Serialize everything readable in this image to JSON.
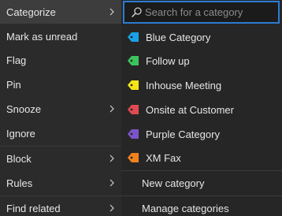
{
  "menu": {
    "items": [
      {
        "label": "Categorize",
        "has_submenu": true,
        "active": true
      },
      {
        "label": "Mark as unread",
        "has_submenu": false
      },
      {
        "label": "Flag",
        "has_submenu": false
      },
      {
        "label": "Pin",
        "has_submenu": false
      },
      {
        "label": "Snooze",
        "has_submenu": true
      },
      {
        "label": "Ignore",
        "has_submenu": false
      },
      {
        "label": "Block",
        "has_submenu": true
      },
      {
        "label": "Rules",
        "has_submenu": true
      },
      {
        "label": "Find related",
        "has_submenu": true
      }
    ]
  },
  "submenu": {
    "search_placeholder": "Search for a category",
    "categories": [
      {
        "label": "Blue Category",
        "color": "#1aa1e6"
      },
      {
        "label": "Follow up",
        "color": "#3cc45c"
      },
      {
        "label": "Inhouse Meeting",
        "color": "#f3e41a"
      },
      {
        "label": "Onsite at Customer",
        "color": "#e04a52"
      },
      {
        "label": "Purple Category",
        "color": "#7a55c8"
      },
      {
        "label": "XM Fax",
        "color": "#f0821e"
      }
    ],
    "new_category": "New category",
    "manage_categories": "Manage categories"
  }
}
